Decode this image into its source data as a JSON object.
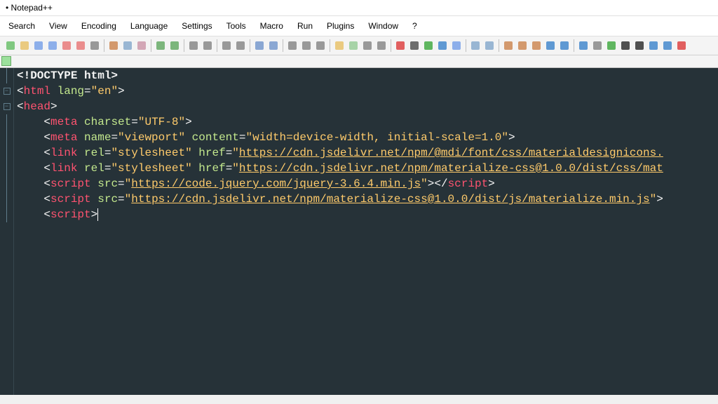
{
  "app": {
    "title": "Notepad++"
  },
  "menu": [
    "Search",
    "View",
    "Encoding",
    "Language",
    "Settings",
    "Tools",
    "Macro",
    "Run",
    "Plugins",
    "Window",
    "?"
  ],
  "toolbar_icons": [
    "new-file-icon",
    "open-file-icon",
    "save-icon",
    "save-all-icon",
    "close-icon",
    "close-all-icon",
    "print-icon",
    "|",
    "cut-icon",
    "copy-icon",
    "paste-icon",
    "|",
    "undo-icon",
    "redo-icon",
    "|",
    "find-icon",
    "replace-icon",
    "|",
    "zoom-in-icon",
    "zoom-out-icon",
    "|",
    "sync-v-icon",
    "sync-h-icon",
    "|",
    "wordwrap-icon",
    "all-chars-icon",
    "indent-icon",
    "|",
    "folder-browse-icon",
    "doc-map-icon",
    "doc-list-icon",
    "func-list-icon",
    "|",
    "record-icon",
    "stop-icon",
    "play-icon",
    "playloop-icon",
    "save-macro-icon",
    "|",
    "indent-left-icon",
    "indent-right-icon",
    "|",
    "bookmark-icon",
    "bookmark-next-icon",
    "bookmark-prev-icon",
    "sort-icon",
    "arrow-up-icon",
    "|",
    "check-icon",
    "grid-icon",
    "spellcheck-icon",
    "bold-icon",
    "js-icon",
    "expand-icon",
    "code-icon",
    "close-red-icon"
  ],
  "code": {
    "lines": [
      {
        "indent": 0,
        "tokens": [
          {
            "t": "doctype",
            "v": "<!DOCTYPE html>"
          }
        ]
      },
      {
        "indent": 0,
        "fold": "-",
        "tokens": [
          {
            "t": "br",
            "v": "<"
          },
          {
            "t": "tag",
            "v": "html"
          },
          {
            "t": "sp",
            "v": " "
          },
          {
            "t": "attr",
            "v": "lang"
          },
          {
            "t": "eq",
            "v": "="
          },
          {
            "t": "str",
            "v": "\"en\""
          },
          {
            "t": "br",
            "v": ">"
          }
        ]
      },
      {
        "indent": 0,
        "fold": "-",
        "tokens": [
          {
            "t": "br",
            "v": "<"
          },
          {
            "t": "tag",
            "v": "head"
          },
          {
            "t": "br",
            "v": ">"
          }
        ]
      },
      {
        "indent": 1,
        "tokens": [
          {
            "t": "br",
            "v": "<"
          },
          {
            "t": "tag",
            "v": "meta"
          },
          {
            "t": "sp",
            "v": " "
          },
          {
            "t": "attr",
            "v": "charset"
          },
          {
            "t": "eq",
            "v": "="
          },
          {
            "t": "str",
            "v": "\"UTF-8\""
          },
          {
            "t": "br",
            "v": ">"
          }
        ]
      },
      {
        "indent": 1,
        "tokens": [
          {
            "t": "br",
            "v": "<"
          },
          {
            "t": "tag",
            "v": "meta"
          },
          {
            "t": "sp",
            "v": " "
          },
          {
            "t": "attr",
            "v": "name"
          },
          {
            "t": "eq",
            "v": "="
          },
          {
            "t": "str",
            "v": "\"viewport\""
          },
          {
            "t": "sp",
            "v": " "
          },
          {
            "t": "attr",
            "v": "content"
          },
          {
            "t": "eq",
            "v": "="
          },
          {
            "t": "str",
            "v": "\"width=device-width, initial-scale=1.0\""
          },
          {
            "t": "br",
            "v": ">"
          }
        ]
      },
      {
        "indent": 1,
        "tokens": [
          {
            "t": "br",
            "v": "<"
          },
          {
            "t": "tag",
            "v": "link"
          },
          {
            "t": "sp",
            "v": " "
          },
          {
            "t": "attr",
            "v": "rel"
          },
          {
            "t": "eq",
            "v": "="
          },
          {
            "t": "str",
            "v": "\"stylesheet\""
          },
          {
            "t": "sp",
            "v": " "
          },
          {
            "t": "attr",
            "v": "href"
          },
          {
            "t": "eq",
            "v": "="
          },
          {
            "t": "str",
            "v": "\""
          },
          {
            "t": "url",
            "v": "https://cdn.jsdelivr.net/npm/@mdi/font/css/materialdesignicons."
          }
        ]
      },
      {
        "indent": 1,
        "tokens": [
          {
            "t": "br",
            "v": "<"
          },
          {
            "t": "tag",
            "v": "link"
          },
          {
            "t": "sp",
            "v": " "
          },
          {
            "t": "attr",
            "v": "rel"
          },
          {
            "t": "eq",
            "v": "="
          },
          {
            "t": "str",
            "v": "\"stylesheet\""
          },
          {
            "t": "sp",
            "v": " "
          },
          {
            "t": "attr",
            "v": "href"
          },
          {
            "t": "eq",
            "v": "="
          },
          {
            "t": "str",
            "v": "\""
          },
          {
            "t": "url",
            "v": "https://cdn.jsdelivr.net/npm/materialize-css@1.0.0/dist/css/mat"
          }
        ]
      },
      {
        "indent": 1,
        "tokens": [
          {
            "t": "br",
            "v": "<"
          },
          {
            "t": "tag",
            "v": "script"
          },
          {
            "t": "sp",
            "v": " "
          },
          {
            "t": "attr",
            "v": "src"
          },
          {
            "t": "eq",
            "v": "="
          },
          {
            "t": "str",
            "v": "\""
          },
          {
            "t": "url",
            "v": "https://code.jquery.com/jquery-3.6.4.min.js"
          },
          {
            "t": "str",
            "v": "\""
          },
          {
            "t": "br",
            "v": "></"
          },
          {
            "t": "tag",
            "v": "script"
          },
          {
            "t": "br",
            "v": ">"
          }
        ]
      },
      {
        "indent": 1,
        "tokens": [
          {
            "t": "br",
            "v": "<"
          },
          {
            "t": "tag",
            "v": "script"
          },
          {
            "t": "sp",
            "v": " "
          },
          {
            "t": "attr",
            "v": "src"
          },
          {
            "t": "eq",
            "v": "="
          },
          {
            "t": "str",
            "v": "\""
          },
          {
            "t": "url",
            "v": "https://cdn.jsdelivr.net/npm/materialize-css@1.0.0/dist/js/materialize.min.js"
          },
          {
            "t": "str",
            "v": "\""
          },
          {
            "t": "br",
            "v": ">"
          }
        ]
      },
      {
        "indent": 1,
        "tokens": [
          {
            "t": "br",
            "v": "<"
          },
          {
            "t": "tag",
            "v": "script"
          },
          {
            "t": "br",
            "v": ">"
          },
          {
            "t": "cursor",
            "v": ""
          }
        ]
      }
    ]
  }
}
